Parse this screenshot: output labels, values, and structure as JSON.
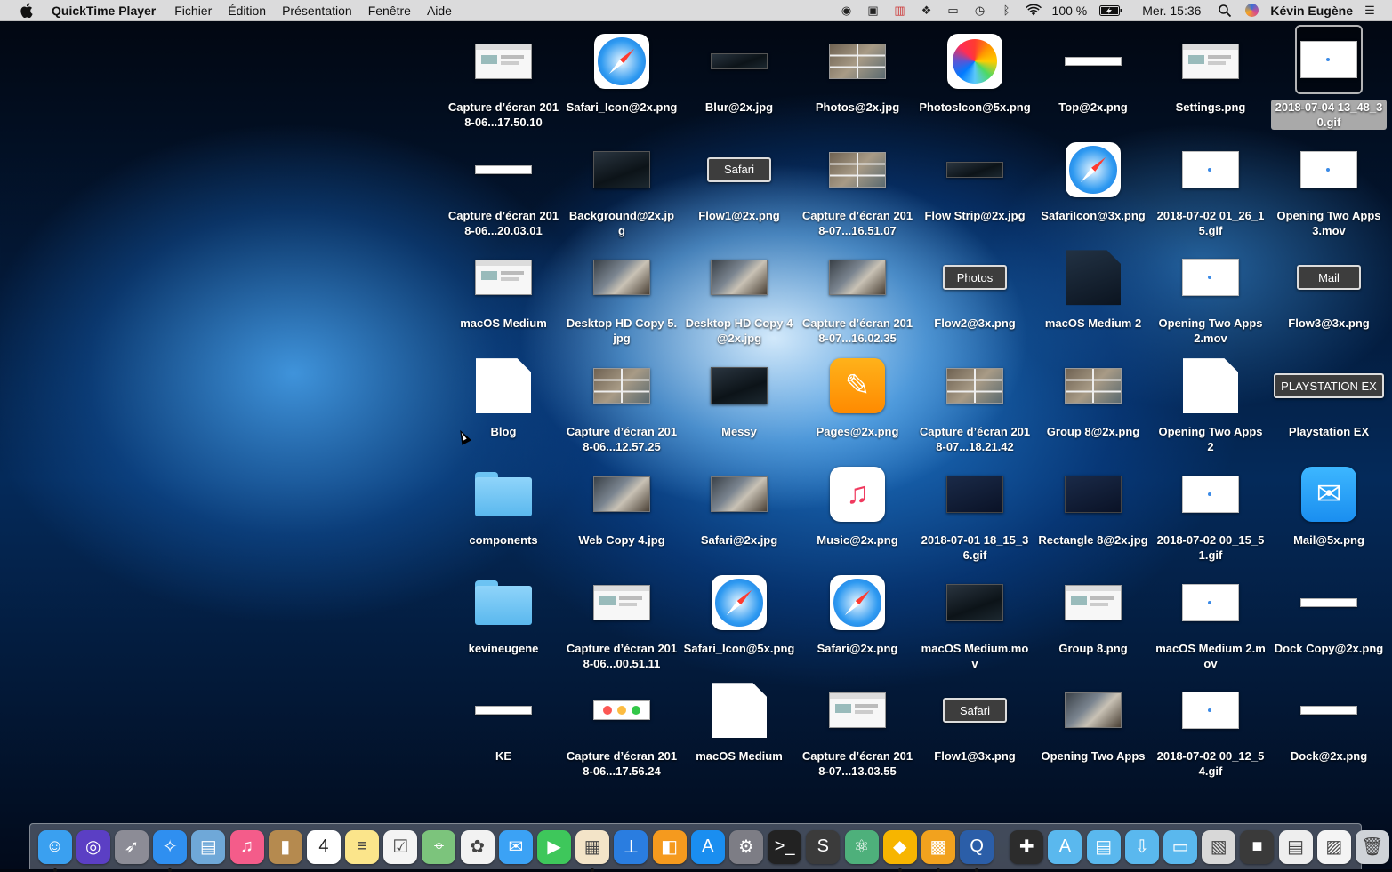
{
  "menubar": {
    "apple_icon": "apple-logo",
    "app_name": "QuickTime Player",
    "menus": [
      "Fichier",
      "Édition",
      "Présentation",
      "Fenêtre",
      "Aide"
    ],
    "status_icons": [
      "record-icon",
      "paste-icon",
      "stats-icon",
      "dropbox-icon",
      "airplay-icon",
      "time-machine-icon",
      "bluetooth-icon",
      "wifi-icon"
    ],
    "battery_text": "100 %",
    "battery_icon": "battery-charging-icon",
    "clock": "Mer. 15:36",
    "user": "Kévin Eugène"
  },
  "desktop": {
    "rows": [
      [
        {
          "label": "Capture d’écran 2018-06...17.50.10",
          "kind": "shot"
        },
        {
          "label": "Safari_Icon@2x.png",
          "kind": "safari"
        },
        {
          "label": "Blur@2x.jpg",
          "kind": "darkstrip"
        },
        {
          "label": "Photos@2x.jpg",
          "kind": "grid"
        },
        {
          "label": "PhotosIcon@5x.png",
          "kind": "photosicon"
        },
        {
          "label": "Top@2x.png",
          "kind": "strip"
        },
        {
          "label": "Settings.png",
          "kind": "shot"
        },
        {
          "label": "2018-07-04 13_48_30.gif",
          "kind": "white",
          "selected": true
        }
      ],
      [
        {
          "label": "Capture d’écran 2018-06...20.03.01",
          "kind": "strip"
        },
        {
          "label": "Background@2x.jpg",
          "kind": "dark"
        },
        {
          "label": "Flow1@2x.png",
          "kind": "pill",
          "pill": "Safari"
        },
        {
          "label": "Capture d’écran 2018-07...16.51.07",
          "kind": "grid"
        },
        {
          "label": "Flow Strip@2x.jpg",
          "kind": "darkstrip"
        },
        {
          "label": "SafariIcon@3x.png",
          "kind": "safari"
        },
        {
          "label": "2018-07-02 01_26_15.gif",
          "kind": "white"
        },
        {
          "label": "Opening Two Apps 3.mov",
          "kind": "white"
        }
      ],
      [
        {
          "label": "macOS Medium",
          "kind": "shot"
        },
        {
          "label": "Desktop HD Copy 5.jpg",
          "kind": "photo"
        },
        {
          "label": "Desktop HD Copy 4@2x.jpg",
          "kind": "photo"
        },
        {
          "label": "Capture d’écran 2018-07...16.02.35",
          "kind": "photo"
        },
        {
          "label": "Flow2@3x.png",
          "kind": "pill",
          "pill": "Photos"
        },
        {
          "label": "macOS Medium 2",
          "kind": "darkdoc"
        },
        {
          "label": "Opening Two Apps 2.mov",
          "kind": "white"
        },
        {
          "label": "Flow3@3x.png",
          "kind": "pill",
          "pill": "Mail"
        }
      ],
      [
        {
          "label": "Blog",
          "kind": "doc"
        },
        {
          "label": "Capture d’écran 2018-06...12.57.25",
          "kind": "grid"
        },
        {
          "label": "Messy",
          "kind": "dark"
        },
        {
          "label": "Pages@2x.png",
          "kind": "pages"
        },
        {
          "label": "Capture d’écran 2018-07...18.21.42",
          "kind": "grid"
        },
        {
          "label": "Group 8@2x.png",
          "kind": "grid"
        },
        {
          "label": "Opening Two Apps 2",
          "kind": "doc"
        },
        {
          "label": "Playstation EX",
          "kind": "pill",
          "pill": "PLAYSTATION EX"
        }
      ],
      [
        {
          "label": "components",
          "kind": "folder"
        },
        {
          "label": "Web Copy 4.jpg",
          "kind": "photo"
        },
        {
          "label": "Safari@2x.jpg",
          "kind": "photo"
        },
        {
          "label": "Music@2x.png",
          "kind": "music"
        },
        {
          "label": "2018-07-01 18_15_36.gif",
          "kind": "darkblue"
        },
        {
          "label": "Rectangle 8@2x.jpg",
          "kind": "darkblue"
        },
        {
          "label": "2018-07-02 00_15_51.gif",
          "kind": "white"
        },
        {
          "label": "Mail@5x.png",
          "kind": "mail"
        }
      ],
      [
        {
          "label": "kevineugene",
          "kind": "folder"
        },
        {
          "label": "Capture d’écran 2018-06...00.51.11",
          "kind": "shot"
        },
        {
          "label": "Safari_Icon@5x.png",
          "kind": "safari"
        },
        {
          "label": "Safari@2x.png",
          "kind": "safari"
        },
        {
          "label": "macOS Medium.mov",
          "kind": "dark"
        },
        {
          "label": "Group 8.png",
          "kind": "shot"
        },
        {
          "label": "macOS Medium 2.mov",
          "kind": "white"
        },
        {
          "label": "Dock Copy@2x.png",
          "kind": "strip"
        }
      ],
      [
        {
          "label": "KE",
          "kind": "strip"
        },
        {
          "label": "Capture d’écran 2018-06...17.56.24",
          "kind": "traffic"
        },
        {
          "label": "macOS Medium",
          "kind": "doc"
        },
        {
          "label": "Capture d’écran 2018-07...13.03.55",
          "kind": "shot"
        },
        {
          "label": "Flow1@3x.png",
          "kind": "pill",
          "pill": "Safari"
        },
        {
          "label": "Opening Two Apps",
          "kind": "photo"
        },
        {
          "label": "2018-07-02 00_12_54.gif",
          "kind": "white"
        },
        {
          "label": "Dock@2x.png",
          "kind": "strip"
        }
      ]
    ]
  },
  "dock": {
    "apps": [
      {
        "name": "finder-icon",
        "color": "#3aa0f0",
        "running": true
      },
      {
        "name": "siri-icon",
        "color": "#5b3fc4",
        "running": false
      },
      {
        "name": "launchpad-icon",
        "color": "#8c8c96",
        "running": false
      },
      {
        "name": "safari-icon",
        "color": "#2f8ff0",
        "running": true
      },
      {
        "name": "preview-icon",
        "color": "#6fa8d8",
        "running": false
      },
      {
        "name": "itunes-icon",
        "color": "#f45c8a",
        "running": false
      },
      {
        "name": "notebook-icon",
        "color": "#b58a4f",
        "running": false
      },
      {
        "name": "calendar-icon",
        "color": "#ffffff",
        "running": false
      },
      {
        "name": "notes-icon",
        "color": "#fbe58b",
        "running": false
      },
      {
        "name": "reminders-icon",
        "color": "#f4f4f4",
        "running": false
      },
      {
        "name": "maps-icon",
        "color": "#7cc47c",
        "running": false
      },
      {
        "name": "photos-icon",
        "color": "#f2f2f2",
        "running": false
      },
      {
        "name": "messages-icon",
        "color": "#3ba2f5",
        "running": false
      },
      {
        "name": "facetime-icon",
        "color": "#3ec75b",
        "running": false
      },
      {
        "name": "pasteboard-icon",
        "color": "#f3e4c8",
        "running": true
      },
      {
        "name": "keynote-icon",
        "color": "#2a7de0",
        "running": false
      },
      {
        "name": "ibooks-icon",
        "color": "#f59a1e",
        "running": false
      },
      {
        "name": "app-store-icon",
        "color": "#1a8ef0",
        "running": false
      },
      {
        "name": "system-preferences-icon",
        "color": "#7d7d85",
        "running": false
      },
      {
        "name": "terminal-icon",
        "color": "#222222",
        "running": false
      },
      {
        "name": "sublime-icon",
        "color": "#3b3b3b",
        "running": false
      },
      {
        "name": "atom-icon",
        "color": "#4eb07b",
        "running": false
      },
      {
        "name": "sketch-icon",
        "color": "#f7b500",
        "running": true
      },
      {
        "name": "principle-icon",
        "color": "#f2a21e",
        "running": true
      },
      {
        "name": "quicktime-icon",
        "color": "#2b5ea8",
        "running": true
      }
    ],
    "others": [
      {
        "name": "gamepad-icon",
        "color": "#2c2c2c"
      },
      {
        "name": "applications-folder-icon",
        "color": "#5ab8ee"
      },
      {
        "name": "documents-folder-icon",
        "color": "#5ab8ee"
      },
      {
        "name": "downloads-folder-icon",
        "color": "#5ab8ee"
      },
      {
        "name": "folder-icon",
        "color": "#5ab8ee"
      },
      {
        "name": "stack-icon",
        "color": "#d8d8d8"
      },
      {
        "name": "dark-stack-icon",
        "color": "#3a3a3a"
      },
      {
        "name": "document-stack-icon",
        "color": "#eeeeee"
      },
      {
        "name": "screenshot-stack-icon",
        "color": "#f4f4f4"
      },
      {
        "name": "trash-icon",
        "color": "#cfd3d8"
      }
    ]
  }
}
